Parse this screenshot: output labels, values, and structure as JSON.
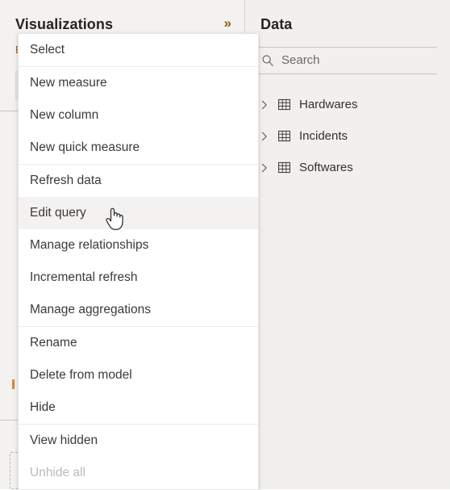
{
  "visualizations_pane": {
    "title": "Visualizations",
    "expand_icon": "double-chevron-right-icon",
    "build_label": "B"
  },
  "data_pane": {
    "title": "Data",
    "search": {
      "icon": "search-icon",
      "placeholder": "Search",
      "value": ""
    },
    "tree": [
      {
        "label": "Hardwares",
        "icon": "table-icon",
        "chevron": "chevron-right-icon",
        "expanded": false
      },
      {
        "label": "Incidents",
        "icon": "table-icon",
        "chevron": "chevron-right-icon",
        "expanded": false
      },
      {
        "label": "Softwares",
        "icon": "table-icon",
        "chevron": "chevron-right-icon",
        "expanded": false
      }
    ]
  },
  "context_menu": {
    "items": [
      {
        "label": "Select",
        "state": "normal",
        "separator_after": true
      },
      {
        "label": "New measure",
        "state": "normal",
        "separator_after": false
      },
      {
        "label": "New column",
        "state": "normal",
        "separator_after": false
      },
      {
        "label": "New quick measure",
        "state": "normal",
        "separator_after": true
      },
      {
        "label": "Refresh data",
        "state": "normal",
        "separator_after": false
      },
      {
        "label": "Edit query",
        "state": "highlighted",
        "separator_after": false
      },
      {
        "label": "Manage relationships",
        "state": "normal",
        "separator_after": false
      },
      {
        "label": "Incremental refresh",
        "state": "normal",
        "separator_after": false
      },
      {
        "label": "Manage aggregations",
        "state": "normal",
        "separator_after": true
      },
      {
        "label": "Rename",
        "state": "normal",
        "separator_after": false
      },
      {
        "label": "Delete from model",
        "state": "normal",
        "separator_after": false
      },
      {
        "label": "Hide",
        "state": "normal",
        "separator_after": true
      },
      {
        "label": "View hidden",
        "state": "normal",
        "separator_after": false
      },
      {
        "label": "Unhide all",
        "state": "disabled",
        "separator_after": false
      }
    ]
  },
  "cursor": {
    "type": "pointing-hand-cursor",
    "on_item": "Edit query"
  },
  "colors": {
    "accent": "#8a5a12",
    "panel_bg": "#f1f0ef",
    "menu_bg": "#ffffff",
    "menu_highlight": "#f3f2f1",
    "text": "#3b3a39",
    "disabled_text": "#bdbbb9",
    "divider": "#c8c6c4"
  }
}
